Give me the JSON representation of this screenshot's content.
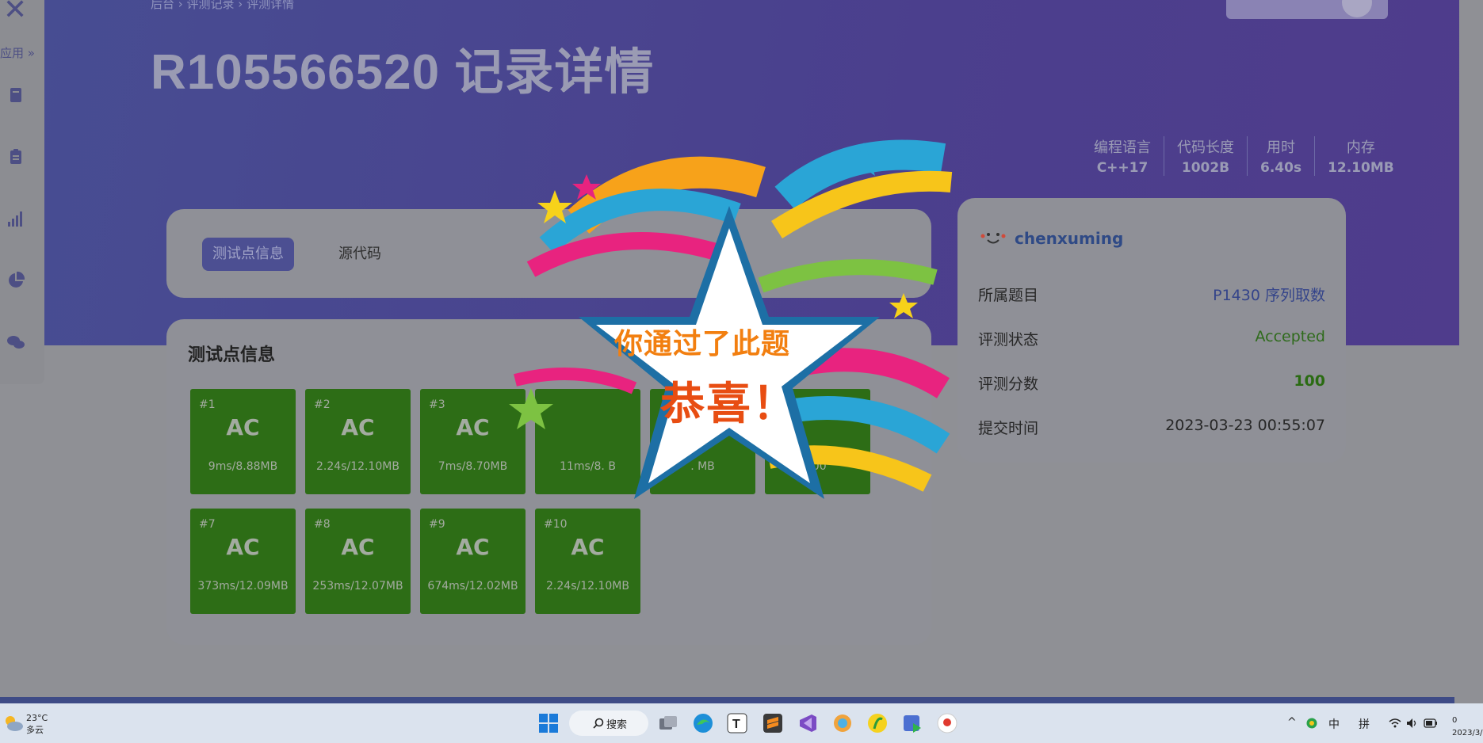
{
  "header": {
    "breadcrumb": "后台 › 评测记录 › 评测详情",
    "title": "R105566520 记录详情",
    "stats": [
      {
        "label": "编程语言",
        "value": "C++17"
      },
      {
        "label": "代码长度",
        "value": "1002B"
      },
      {
        "label": "用时",
        "value": "6.40s"
      },
      {
        "label": "内存",
        "value": "12.10MB"
      }
    ]
  },
  "sidebar": {
    "apps_label": "应用 »"
  },
  "tabs": {
    "active": "测试点信息",
    "inactive": "源代码"
  },
  "tests": {
    "title": "测试点信息",
    "items": [
      {
        "num": "#1",
        "res": "AC",
        "time": "9ms/8.88MB"
      },
      {
        "num": "#2",
        "res": "AC",
        "time": "2.24s/12.10MB"
      },
      {
        "num": "#3",
        "res": "AC",
        "time": "7ms/8.70MB"
      },
      {
        "num": "",
        "res": "",
        "time": "11ms/8.  B"
      },
      {
        "num": "",
        "res": "",
        "time": ".  MB"
      },
      {
        "num": "",
        "res": "",
        "time": ".00"
      },
      {
        "num": "#7",
        "res": "AC",
        "time": "373ms/12.09MB"
      },
      {
        "num": "#8",
        "res": "AC",
        "time": "253ms/12.07MB"
      },
      {
        "num": "#9",
        "res": "AC",
        "time": "674ms/12.02MB"
      },
      {
        "num": "#10",
        "res": "AC",
        "time": "2.24s/12.10MB"
      }
    ]
  },
  "info": {
    "username": "chenxuming",
    "rows": [
      {
        "label": "所属题目",
        "value": "P1430 序列取数"
      },
      {
        "label": "评测状态",
        "value": "Accepted"
      },
      {
        "label": "评测分数",
        "value": "100"
      },
      {
        "label": "提交时间",
        "value": "2023-03-23 00:55:07"
      }
    ]
  },
  "overlay": {
    "line1": "你通过了此题",
    "line2": "恭喜！"
  },
  "taskbar": {
    "weather_temp": "23°C",
    "weather_desc": "多云",
    "search": "搜索",
    "ime1": "中",
    "ime2": "拼",
    "time_partial": "0",
    "date_partial": "2023/3/"
  }
}
